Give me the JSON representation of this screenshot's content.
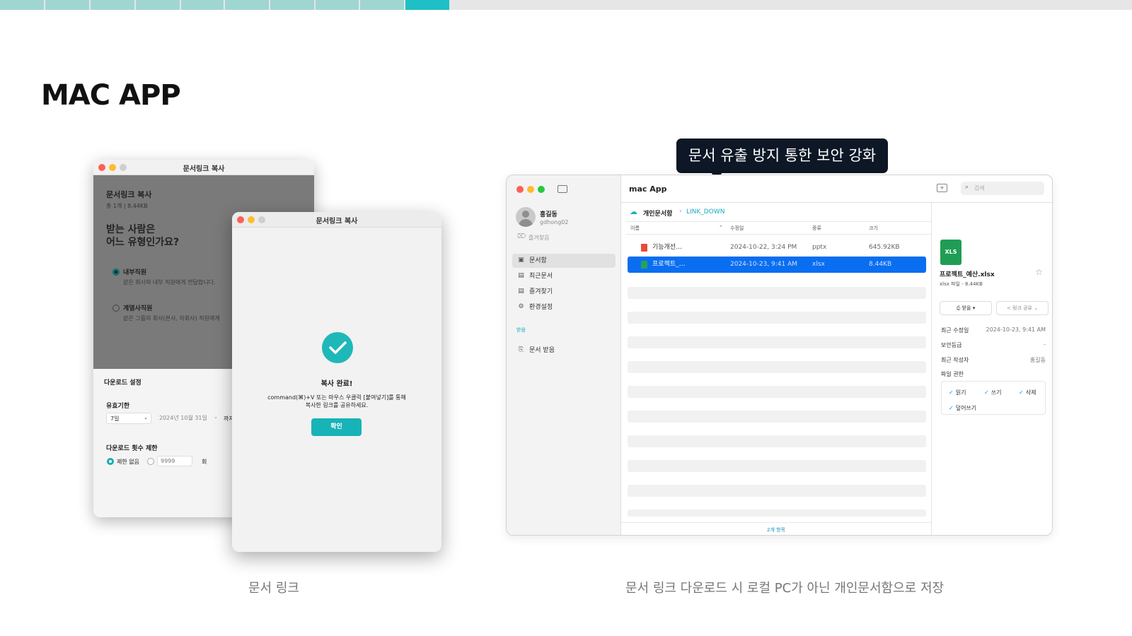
{
  "progress": {
    "segments_done": 9,
    "segment_colors": [
      "#9fd6d2",
      "#1ec0c6",
      "#e6e6e6"
    ]
  },
  "slide": {
    "title": "MAC APP",
    "caption_left": "문서 링크",
    "caption_right": "문서 링크 다운로드 시 로컬 PC가 아닌 개인문서함으로 저장",
    "tooltip": "문서 유출 방지 통한 보안 강화"
  },
  "back_window": {
    "title": "문서링크 복사",
    "heading": "문서링크 복사",
    "meta": "총 1개 | 8.44KB",
    "question": [
      "받는 사람은",
      "어느 유형인가요?"
    ],
    "options": [
      {
        "label": "내부직원",
        "desc": "같은 회사의 내부 직원에게 전달합니다.",
        "selected": true
      },
      {
        "label": "계열사직원",
        "desc": "같은 그룹의 회사(본사, 자회사) 직원에게",
        "selected": false
      }
    ],
    "download_settings": {
      "heading": "다운로드 설정",
      "validity_label": "유효기한",
      "validity_value": "7일",
      "date_value": "2024년 10월 31일",
      "until": "까지",
      "limit_label": "다운로드 횟수 제한",
      "no_limit": "제한 없음",
      "count_placeholder": "9999",
      "count_unit": "회"
    }
  },
  "front_window": {
    "title": "문서링크 복사",
    "heading": "복사 완료!",
    "message_line1": "command(⌘)+V 또는 마우스 우클릭 [붙여넣기]를 통해",
    "message_line2": "복사한 링크를 공유하세요.",
    "ok_button": "확인"
  },
  "mac_app": {
    "title": "mac App",
    "search_placeholder": "검색",
    "user": {
      "name": "홍길동",
      "id": "gdhong02"
    },
    "favorites_label": "즐겨찾음",
    "sidebar_items": [
      {
        "label": "문서함",
        "icon": "folder-icon",
        "active": true
      },
      {
        "label": "최근문서",
        "icon": "recent-doc-icon",
        "active": false
      },
      {
        "label": "즐겨찾기",
        "icon": "star-doc-icon",
        "active": false
      },
      {
        "label": "환경설정",
        "icon": "settings-icon",
        "active": false
      }
    ],
    "received_section": "받음",
    "received_item": "문서 받음",
    "breadcrumb": [
      "개인문서함",
      "LINK_DOWN"
    ],
    "columns": [
      "이름",
      "수정일",
      "종류",
      "크기"
    ],
    "files": [
      {
        "name": "기능개선…",
        "modified": "2024-10-22, 3:24 PM",
        "kind": "pptx",
        "size": "645.92KB",
        "selected": false
      },
      {
        "name": "프로젝트_…",
        "modified": "2024-10-23, 9:41 AM",
        "kind": "xlsx",
        "size": "8.44KB",
        "selected": true
      }
    ],
    "footer": "2개 항목",
    "detail": {
      "file_name": "프로젝트_예산.xlsx",
      "file_meta": "xlsx 파일 - 8.44KB",
      "btn_receive": "받을",
      "btn_share": "링크 공유",
      "rows": [
        {
          "label": "최근 수정일",
          "value": "2024-10-23, 9:41 AM"
        },
        {
          "label": "보안등급",
          "value": "-"
        },
        {
          "label": "최근 작성자",
          "value": "홍길동"
        }
      ],
      "permissions_label": "파일 권한",
      "permissions": [
        "읽기",
        "쓰기",
        "삭제",
        "덮어쓰기"
      ]
    }
  }
}
